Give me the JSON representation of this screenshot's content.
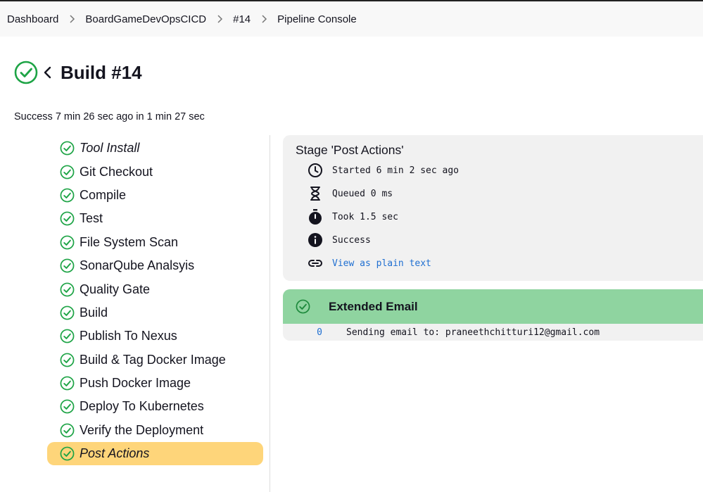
{
  "breadcrumb": [
    "Dashboard",
    "BoardGameDevOpsCICD",
    "#14",
    "Pipeline Console"
  ],
  "build": {
    "title": "Build #14",
    "summary": "Success 7 min 26 sec ago in 1 min 27 sec"
  },
  "stages": [
    {
      "label": "Tool Install",
      "italic": true,
      "selected": false
    },
    {
      "label": "Git Checkout",
      "italic": false,
      "selected": false
    },
    {
      "label": "Compile",
      "italic": false,
      "selected": false
    },
    {
      "label": "Test",
      "italic": false,
      "selected": false
    },
    {
      "label": "File System Scan",
      "italic": false,
      "selected": false
    },
    {
      "label": "SonarQube Analsyis",
      "italic": false,
      "selected": false
    },
    {
      "label": "Quality Gate",
      "italic": false,
      "selected": false
    },
    {
      "label": "Build",
      "italic": false,
      "selected": false
    },
    {
      "label": "Publish To Nexus",
      "italic": false,
      "selected": false
    },
    {
      "label": "Build & Tag Docker Image",
      "italic": false,
      "selected": false
    },
    {
      "label": "Push Docker Image",
      "italic": false,
      "selected": false
    },
    {
      "label": "Deploy To Kubernetes",
      "italic": false,
      "selected": false
    },
    {
      "label": "Verify the Deployment",
      "italic": false,
      "selected": false
    },
    {
      "label": "Post Actions",
      "italic": true,
      "selected": true
    }
  ],
  "stage_detail": {
    "title": "Stage 'Post Actions'",
    "started": "Started 6 min 2 sec ago",
    "queued": "Queued 0 ms",
    "took": "Took 1.5 sec",
    "status": "Success",
    "plain_text_link": "View as plain text"
  },
  "step": {
    "title": "Extended Email",
    "log_lines": [
      {
        "num": "0",
        "text": "Sending email to: praneethchitturi12@gmail.com"
      }
    ]
  },
  "colors": {
    "success": "#1ea446",
    "selected_stage": "#fed57a",
    "step_header": "#8fd4a0",
    "link": "#1f6fd1"
  },
  "icons": {
    "status": "check-circle-icon",
    "back": "chevron-left-icon",
    "started": "clock-icon",
    "queued": "hourglass-icon",
    "took": "stopwatch-icon",
    "status_info": "info-icon",
    "link": "link-icon"
  }
}
